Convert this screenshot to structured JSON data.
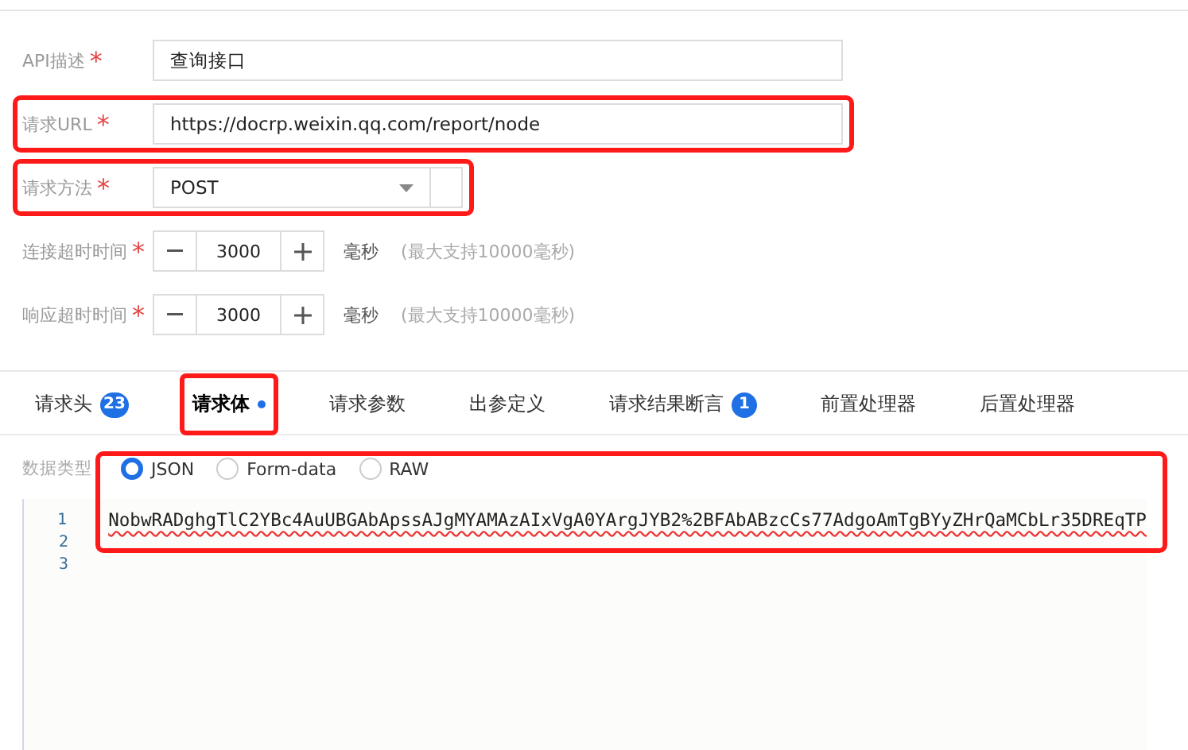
{
  "form": {
    "fields": [
      {
        "kind": "text",
        "label": "API描述",
        "required_mark": "*",
        "value": "查询接口",
        "highlighted": false
      },
      {
        "kind": "text",
        "label": "请求URL",
        "required_mark": "*",
        "value": "https://docrp.weixin.qq.com/report/node",
        "highlighted": true
      },
      {
        "kind": "select",
        "label": "请求方法",
        "required_mark": "*",
        "value": "POST",
        "highlighted": true
      },
      {
        "kind": "stepper",
        "label": "连接超时时间",
        "required_mark": "*",
        "value": "3000",
        "unit": "毫秒",
        "hint": "(最大支持10000毫秒)",
        "highlighted": false
      },
      {
        "kind": "stepper",
        "label": "响应超时时间",
        "required_mark": "*",
        "value": "3000",
        "unit": "毫秒",
        "hint": "(最大支持10000毫秒)",
        "highlighted": false
      }
    ]
  },
  "tabs": [
    {
      "label": "请求头",
      "badge": "23",
      "selected": false,
      "modified": false,
      "highlighted": false
    },
    {
      "label": "请求体",
      "selected": true,
      "modified": true,
      "highlighted": true
    },
    {
      "label": "请求参数",
      "selected": false,
      "modified": false,
      "highlighted": false
    },
    {
      "label": "出参定义",
      "selected": false,
      "modified": false,
      "highlighted": false
    },
    {
      "label": "请求结果断言",
      "badge": "1",
      "selected": false,
      "modified": false,
      "highlighted": false
    },
    {
      "label": "前置处理器",
      "selected": false,
      "modified": false,
      "highlighted": false
    },
    {
      "label": "后置处理器",
      "selected": false,
      "modified": false,
      "highlighted": false
    }
  ],
  "body": {
    "label": "数据类型",
    "highlighted": true,
    "types": [
      {
        "label": "JSON",
        "selected": true
      },
      {
        "label": "Form-data",
        "selected": false
      },
      {
        "label": "RAW",
        "selected": false
      }
    ],
    "lines": [
      {
        "number": "1",
        "text": "NobwRADghgTlC2YBc4AuUBGAbApssAJgMYAMAzAIxVgA0YArgJYB2%2BFAbABzcCs77AdgoAmTgBYyZHrQaMCbLr35DREqTP"
      },
      {
        "number": "2"
      },
      {
        "number": "3"
      }
    ]
  }
}
